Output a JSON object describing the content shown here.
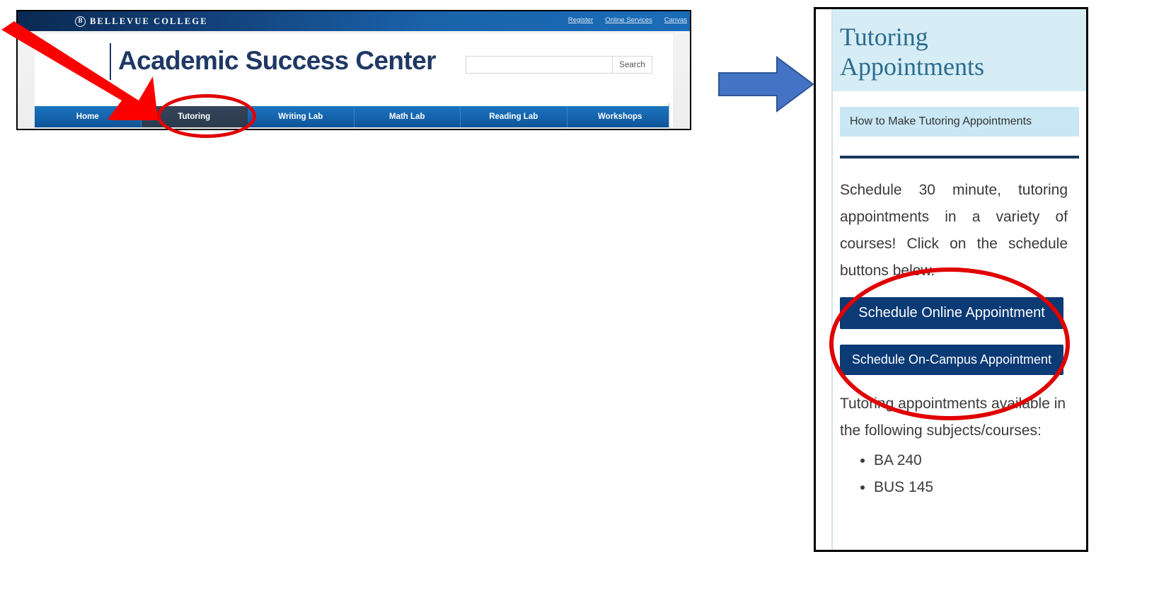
{
  "left_capture": {
    "college_bar": {
      "logo_letter": "B",
      "college_name": "BELLEVUE COLLEGE",
      "top_links": [
        {
          "label": "Register"
        },
        {
          "label": "Online Services"
        },
        {
          "label": "Canvas"
        }
      ]
    },
    "masthead": {
      "site_title": "Academic Success Center",
      "search": {
        "value": "",
        "placeholder": "",
        "button_label": "Search"
      }
    },
    "nav": {
      "items": [
        {
          "label": "Home",
          "active": false
        },
        {
          "label": "Tutoring",
          "active": true
        },
        {
          "label": "Writing Lab",
          "active": false
        },
        {
          "label": "Math Lab",
          "active": false
        },
        {
          "label": "Reading Lab",
          "active": false
        },
        {
          "label": "Workshops",
          "active": false
        }
      ]
    }
  },
  "annotations": {
    "red_arrow_target": "Tutoring",
    "red_color": "#e00000",
    "blue_arrow_color": "#4472c4",
    "blue_arrow_outline": "#2e5597"
  },
  "right_capture": {
    "panel_title": "Tutoring Appointments",
    "howto_chip_label": "How to Make Tutoring Appointments",
    "intro_text": "Schedule 30 minute, tutoring appointments in a variety of courses! Click on the schedule buttons below.",
    "buttons": [
      {
        "label": "Schedule Online Appointment"
      },
      {
        "label": "Schedule On-Campus Appointment"
      }
    ],
    "availability_text": "Tutoring appointments available in the following subjects/courses:",
    "courses": [
      {
        "label": "BA 240"
      },
      {
        "label": "BUS 145"
      }
    ],
    "colors": {
      "header_bg": "#d6edf5",
      "chip_bg": "#c9e7f5",
      "title_color": "#2b6b8f",
      "rule_color": "#17375e",
      "button_bg": "#0b3a75"
    }
  }
}
